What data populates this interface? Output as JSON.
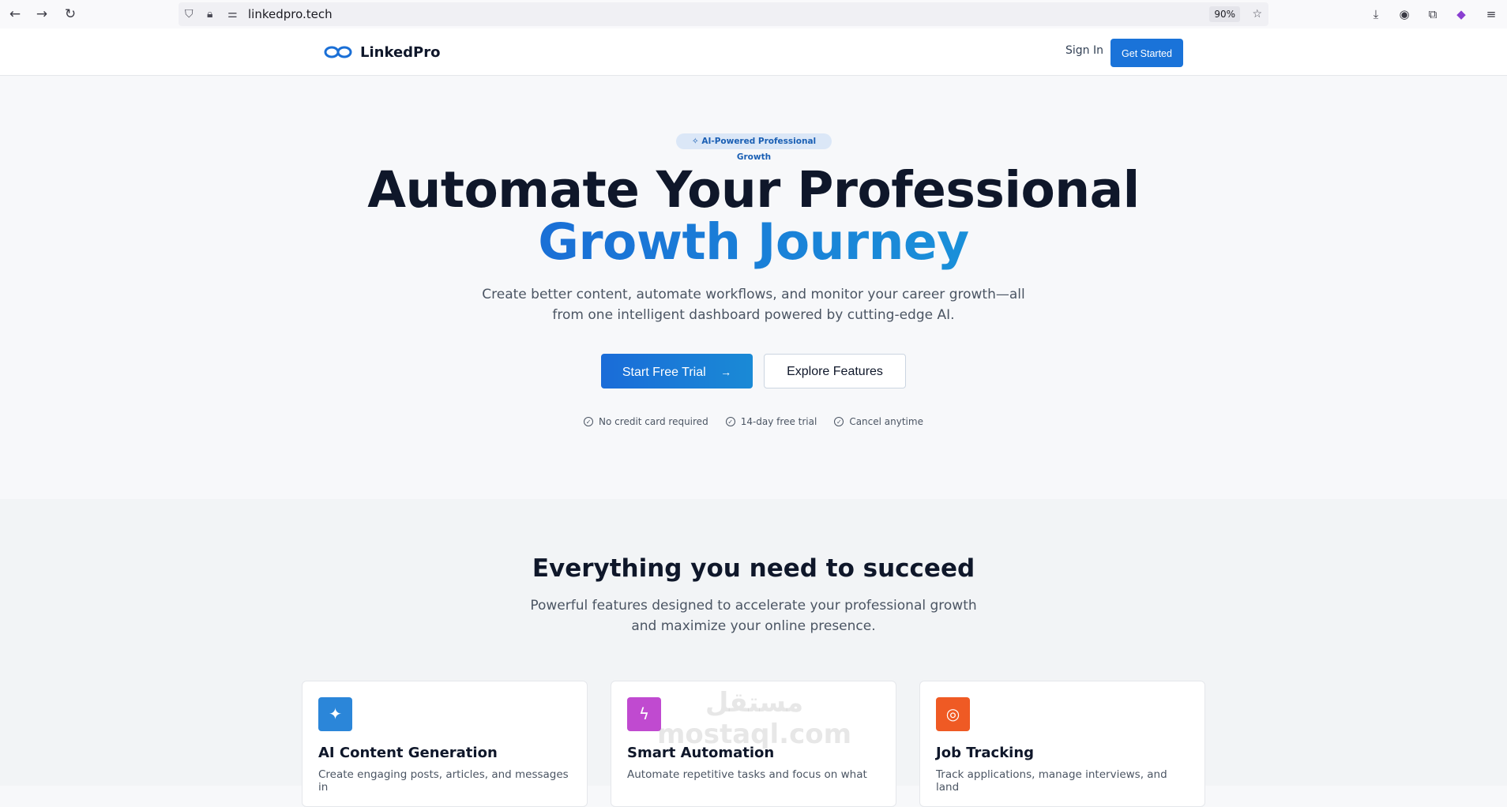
{
  "browser": {
    "url": "linkedpro.tech",
    "zoom": "90%",
    "icons": [
      "back-icon",
      "forward-icon",
      "reload-icon",
      "shield-icon",
      "lock-icon",
      "site-settings-icon",
      "bookmark-star-icon",
      "download-icon",
      "account-icon",
      "extensions-icon",
      "menu-icon"
    ]
  },
  "header": {
    "logo_text": "LinkedPro",
    "sign_in": "Sign In",
    "get_started": "Get Started"
  },
  "hero": {
    "badge": "AI-Powered Professional Growth",
    "title_line1": "Automate Your Professional",
    "title_line2": "Growth Journey",
    "subtitle": "Create better content, automate workflows, and monitor your career growth—all from one intelligent dashboard powered by cutting-edge AI.",
    "primary_button": "Start Free Trial",
    "secondary_button": "Explore Features",
    "perks": [
      "No credit card required",
      "14-day free trial",
      "Cancel anytime"
    ]
  },
  "features": {
    "title": "Everything you need to succeed",
    "subtitle": "Powerful features designed to accelerate your professional growth and maximize your online presence.",
    "cards": [
      {
        "title": "AI Content Generation",
        "desc": "Create engaging posts, articles, and messages in",
        "icon": "sparkles-icon",
        "color": "#2b86d9"
      },
      {
        "title": "Smart Automation",
        "desc": "Automate repetitive tasks and focus on what",
        "icon": "lightning-icon",
        "color": "#c04ad0"
      },
      {
        "title": "Job Tracking",
        "desc": "Track applications, manage interviews, and land",
        "icon": "target-icon",
        "color": "#ef5a24"
      }
    ]
  },
  "watermark": "مستقل mostaql.com",
  "colors": {
    "accent": "#1a73d9",
    "text": "#0f172a",
    "muted": "#4b5563"
  }
}
